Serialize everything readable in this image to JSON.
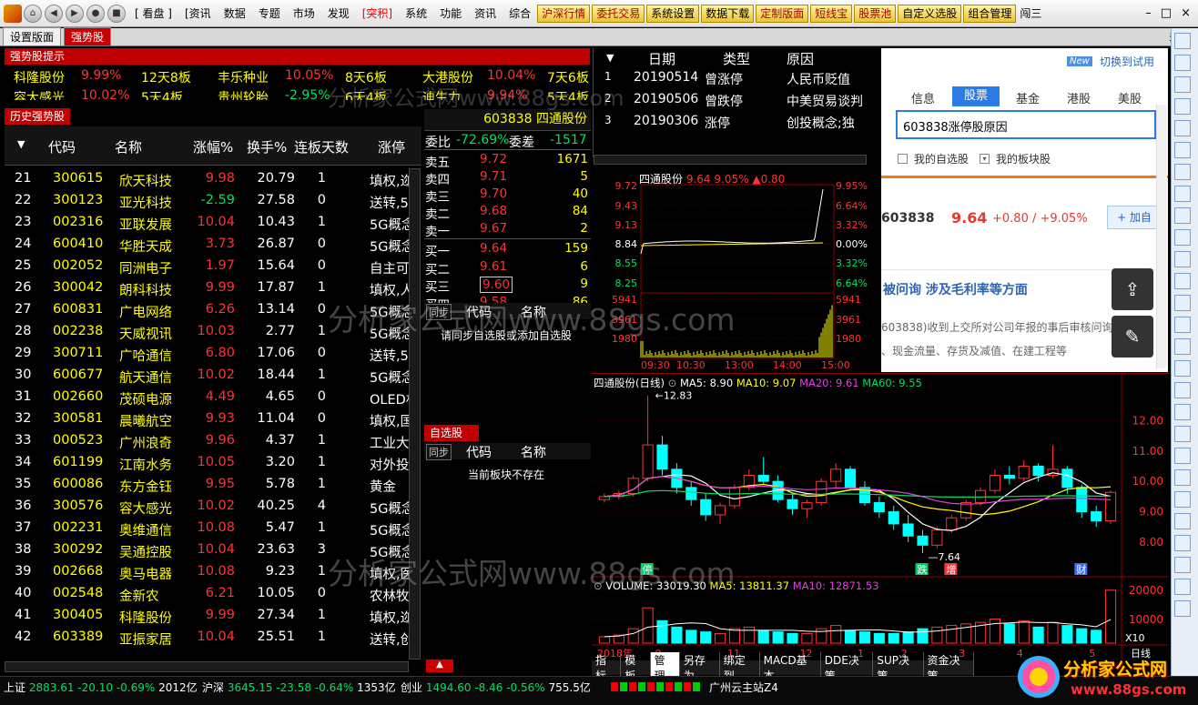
{
  "menu": {
    "nav": [
      "⌂",
      "◀",
      "▶",
      "●",
      "■"
    ],
    "items": [
      "[ 看盘 ]",
      "[资讯",
      "数据",
      "专题",
      "市场",
      "发现",
      "[突积]",
      "系统",
      "功能",
      "资讯",
      "综合"
    ],
    "buttons": [
      "沪深行情",
      "委托交易",
      "系统设置",
      "数据下载",
      "定制版面",
      "短线宝",
      "股票池",
      "自定义选股",
      "组合管理"
    ],
    "more": "闯三",
    "win": [
      "–",
      "□",
      "×"
    ]
  },
  "tabs": [
    "设置版面",
    "强势股"
  ],
  "close": "关闭",
  "hint": {
    "title": "强势股提示",
    "row1": [
      [
        "科隆股份",
        "9.99%",
        "12天8板"
      ],
      [
        "丰乐种业",
        "10.05%",
        "8天6板"
      ],
      [
        "大港股份",
        "10.04%",
        "7天6板"
      ]
    ],
    "row2": [
      [
        "容大感光",
        "10.02%",
        "5天4板"
      ],
      [
        "贵州轮胎",
        "-2.95%",
        "6天4板"
      ],
      [
        "迪生力",
        "9.94%",
        "5天4板"
      ]
    ]
  },
  "history": {
    "title": "历史强势股",
    "cols": [
      "代码",
      "名称",
      "涨幅%",
      "换手%",
      "连板天数",
      "涨停"
    ],
    "rows": [
      [
        "21",
        "300615",
        "欣天科技",
        "9.98",
        "20.79",
        "1",
        "填权,迩"
      ],
      [
        "22",
        "300123",
        "亚光科技",
        "-2.59",
        "27.58",
        "0",
        "送转,5("
      ],
      [
        "23",
        "002316",
        "亚联发展",
        "10.04",
        "10.43",
        "1",
        "5G概念"
      ],
      [
        "24",
        "600410",
        "华胜天成",
        "3.73",
        "26.87",
        "0",
        "5G概念"
      ],
      [
        "25",
        "002052",
        "同洲电子",
        "1.97",
        "15.64",
        "0",
        "自主可"
      ],
      [
        "26",
        "300042",
        "朗科科技",
        "9.99",
        "17.87",
        "1",
        "填权,人"
      ],
      [
        "27",
        "600831",
        "广电网络",
        "6.26",
        "13.14",
        "0",
        "5G概念"
      ],
      [
        "28",
        "002238",
        "天威视讯",
        "10.03",
        "2.77",
        "1",
        "5G概念"
      ],
      [
        "29",
        "300711",
        "广哈通信",
        "6.80",
        "17.06",
        "0",
        "送转,5("
      ],
      [
        "30",
        "600677",
        "航天通信",
        "10.02",
        "18.44",
        "1",
        "5G概念"
      ],
      [
        "31",
        "002660",
        "茂硕电源",
        "4.49",
        "4.65",
        "0",
        "OLED相"
      ],
      [
        "32",
        "300581",
        "晨曦航空",
        "9.93",
        "11.04",
        "0",
        "填权,国"
      ],
      [
        "33",
        "000523",
        "广州浪奇",
        "9.96",
        "4.37",
        "1",
        "工业大"
      ],
      [
        "34",
        "601199",
        "江南水务",
        "10.05",
        "3.20",
        "1",
        "对外投"
      ],
      [
        "35",
        "600086",
        "东方金钰",
        "9.95",
        "5.78",
        "1",
        "黄金"
      ],
      [
        "36",
        "300576",
        "容大感光",
        "10.02",
        "40.25",
        "4",
        "5G概念"
      ],
      [
        "37",
        "002231",
        "奥维通信",
        "10.08",
        "5.47",
        "1",
        "5G概念"
      ],
      [
        "38",
        "300292",
        "吴通控股",
        "10.04",
        "23.63",
        "3",
        "5G概念"
      ],
      [
        "39",
        "002668",
        "奥马电器",
        "10.08",
        "9.23",
        "1",
        "填权,医"
      ],
      [
        "40",
        "002548",
        "金新农",
        "6.21",
        "10.05",
        "0",
        "农林牧"
      ],
      [
        "41",
        "300405",
        "科隆股份",
        "9.99",
        "27.34",
        "1",
        "填权,迩"
      ],
      [
        "42",
        "603389",
        "亚振家居",
        "10.04",
        "25.51",
        "1",
        "送转,创"
      ]
    ]
  },
  "stock": {
    "code": "603838",
    "name": "四通股份",
    "weibi_label": "委比",
    "weibi": "-72.69%",
    "weicha_label": "委差",
    "weicha": "-1517",
    "sells": [
      [
        "卖五",
        "9.72",
        "1671"
      ],
      [
        "卖四",
        "9.71",
        "5"
      ],
      [
        "卖三",
        "9.70",
        "40"
      ],
      [
        "卖二",
        "9.68",
        "84"
      ],
      [
        "卖一",
        "9.67",
        "2"
      ]
    ],
    "buys": [
      [
        "买一",
        "9.64",
        "159"
      ],
      [
        "买二",
        "9.61",
        "6"
      ],
      [
        "买三",
        "9.60",
        "9"
      ],
      [
        "买四",
        "9.58",
        "86"
      ]
    ]
  },
  "sync": {
    "tag": "同步",
    "code": "代码",
    "name": "名称",
    "msg": "请同步自选股或添加自选股"
  },
  "zixuan": {
    "title": "自选股",
    "tag": "同步",
    "code": "代码",
    "name": "名称",
    "msg": "当前板块不存在"
  },
  "events": {
    "cols": [
      "日期",
      "类型",
      "原因"
    ],
    "rows": [
      [
        "1",
        "20190514",
        "曾涨停",
        "人民币贬值"
      ],
      [
        "2",
        "20190506",
        "曾跌停",
        "中美贸易谈判"
      ],
      [
        "3",
        "20190306",
        "涨停",
        "创投概念;独"
      ]
    ]
  },
  "intraday": {
    "title": "四通股份",
    "price": "9.64",
    "pct": "9.05%",
    "chg": "▲0.80",
    "yl": [
      "9.72",
      "9.43",
      "9.13",
      "8.84",
      "8.55",
      "8.25",
      "5941",
      "3961",
      "1980"
    ],
    "yr": [
      "9.95%",
      "6.64%",
      "3.32%",
      "0.00%",
      "3.32%",
      "6.64%",
      "5941",
      "3961",
      "1980"
    ],
    "xt": [
      "09:30",
      "10:30",
      "13:00",
      "14:00",
      "15:00"
    ]
  },
  "search": {
    "tag": "New",
    "switch": "切换到试用",
    "tabs": [
      "信息",
      "股票",
      "基金",
      "港股",
      "美股"
    ],
    "active_tab": "股票",
    "query": "603838涨停股原因",
    "checks": [
      "我的自选股",
      "我的板块股"
    ],
    "code": "603838",
    "price": "9.64",
    "chg": "+0.80 / +9.05%",
    "add": "+ 加自",
    "headline": "被问询 涉及毛利率等方面",
    "text1": "603838)收到上交所对公司年报的事后审核问询函",
    "text2": "、现金流量、存货及减值、在建工程等"
  },
  "daily": {
    "title": "四通股份(日线)",
    "ma5": "MA5: 8.90",
    "ma10": "MA10: 9.07",
    "ma20": "MA20: 9.61",
    "ma60": "MA60: 9.55",
    "hi": "12.83",
    "lo": "7.64",
    "yt": [
      "12.00",
      "11.00",
      "10.00",
      "9.00",
      "8.00"
    ],
    "marks": [
      "停",
      "跌",
      "增",
      "财"
    ],
    "vol": "VOLUME: 33019.30",
    "vma5": "MA5: 13811.37",
    "vma10": "MA10: 12871.53",
    "vyt": [
      "20000",
      "10000"
    ],
    "x10": "X10",
    "xt": [
      "2018年",
      "9",
      "11",
      "12",
      "1",
      "2",
      "3",
      "4",
      "5"
    ],
    "period": "日线",
    "ohlc": [
      [
        9.4,
        9.6,
        9.3,
        9.5
      ],
      [
        9.5,
        9.7,
        9.4,
        9.6
      ],
      [
        9.6,
        10.2,
        9.5,
        10.1
      ],
      [
        10.1,
        12.83,
        10.0,
        11.2
      ],
      [
        11.2,
        11.5,
        10.2,
        10.4
      ],
      [
        10.4,
        10.6,
        9.6,
        9.8
      ],
      [
        9.8,
        10.0,
        9.2,
        9.4
      ],
      [
        9.4,
        9.6,
        8.7,
        8.9
      ],
      [
        8.9,
        9.3,
        8.6,
        9.2
      ],
      [
        9.2,
        9.9,
        9.1,
        9.8
      ],
      [
        9.8,
        10.4,
        9.7,
        10.2
      ],
      [
        10.2,
        10.8,
        9.9,
        10.0
      ],
      [
        10.0,
        10.2,
        9.3,
        9.4
      ],
      [
        9.4,
        9.6,
        8.9,
        9.1
      ],
      [
        9.1,
        9.4,
        8.8,
        9.3
      ],
      [
        9.3,
        10.1,
        9.2,
        10.0
      ],
      [
        10.0,
        10.6,
        9.8,
        10.4
      ],
      [
        10.4,
        10.5,
        9.7,
        9.8
      ],
      [
        9.8,
        10.0,
        9.2,
        9.3
      ],
      [
        9.3,
        9.5,
        8.8,
        9.0
      ],
      [
        9.0,
        9.2,
        8.4,
        8.6
      ],
      [
        8.6,
        8.9,
        8.0,
        8.2
      ],
      [
        8.2,
        8.4,
        7.64,
        7.9
      ],
      [
        7.9,
        8.5,
        7.8,
        8.4
      ],
      [
        8.4,
        8.9,
        8.3,
        8.8
      ],
      [
        8.8,
        9.4,
        8.7,
        9.3
      ],
      [
        9.3,
        9.8,
        9.2,
        9.7
      ],
      [
        9.7,
        10.4,
        9.6,
        10.2
      ],
      [
        10.2,
        10.5,
        9.9,
        10.1
      ],
      [
        10.1,
        10.7,
        10.0,
        10.5
      ],
      [
        10.5,
        10.6,
        10.0,
        10.2
      ],
      [
        10.2,
        11.2,
        10.1,
        10.4
      ],
      [
        10.4,
        10.5,
        9.6,
        9.8
      ],
      [
        9.8,
        9.9,
        8.8,
        9.0
      ],
      [
        9.0,
        9.2,
        8.5,
        8.7
      ],
      [
        8.7,
        9.7,
        8.6,
        9.64
      ]
    ],
    "vols": [
      4,
      5,
      9,
      22,
      14,
      10,
      8,
      7,
      6,
      9,
      10,
      8,
      7,
      6,
      6,
      9,
      11,
      8,
      7,
      6,
      6,
      7,
      9,
      10,
      11,
      12,
      13,
      15,
      12,
      14,
      10,
      13,
      11,
      9,
      8,
      33
    ]
  },
  "bottom_tabs": [
    "指标",
    "模板",
    "管理",
    "另存为",
    "绑定到",
    "MACD基本",
    "DDE决策",
    "SUP决策",
    "资金决策"
  ],
  "status": {
    "sh": [
      "上证",
      "2883.61",
      "-20.10",
      "-0.69%",
      "2012亿"
    ],
    "sz": [
      "沪深",
      "3645.15",
      "-23.58",
      "-0.64%",
      "1353亿"
    ],
    "cy": [
      "创业",
      "1494.60",
      "-8.46",
      "-0.56%",
      "755.5亿"
    ],
    "server": "广州云主站Z4"
  },
  "brand": {
    "name": "分析家公式网",
    "url": "www.88gs.com"
  },
  "watermark": [
    "分析家公式网www.88gs.com",
    "分析家公式网www.88gs.com",
    "分析家公式网www.88gs.com"
  ],
  "colors": {
    "up": "#ff3333",
    "down": "#00e060",
    "bg": "#000000",
    "ma5": "#ffffff",
    "ma10": "#ffff00",
    "ma20": "#e040e0",
    "ma60": "#00e060"
  }
}
